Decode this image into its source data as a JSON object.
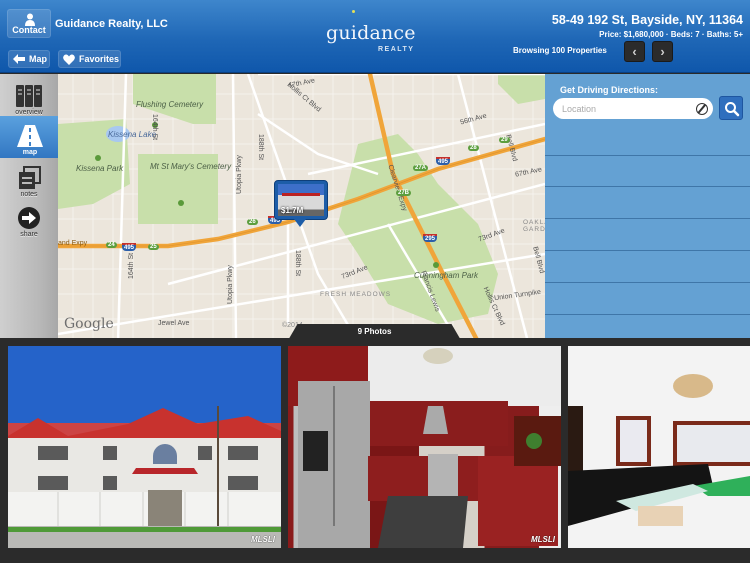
{
  "header": {
    "contact_label": "Contact",
    "company": "Guidance Realty, LLC",
    "map_label": "Map",
    "favorites_label": "Favorites",
    "logo_word": "guidance",
    "logo_sub": "REALTY",
    "address": "58-49 192 St, Bayside, NY, 11364",
    "details": "Price: $1,680,000 · Beds: 7 · Baths: 5+",
    "browsing": "Browsing 100 Properties",
    "prev_glyph": "‹",
    "next_glyph": "›"
  },
  "sidebar": {
    "items": [
      {
        "label": "overview",
        "icon": "columns-icon"
      },
      {
        "label": "map",
        "icon": "road-icon",
        "active": true
      },
      {
        "label": "notes",
        "icon": "notes-icon"
      },
      {
        "label": "share",
        "icon": "share-arrow-icon"
      }
    ]
  },
  "map": {
    "labels": {
      "flushing_cemetery": "Flushing Cemetery",
      "kissena_lake": "Kissena Lake",
      "kissena_park": "Kissena Park",
      "mt_st_marys": "Mt St Mary's Cemetery",
      "cunningham_park": "Cunningham Park",
      "fresh_meadows": "FRESH MEADOWS",
      "oakland_gardens": "OAKLA GARDE",
      "ave_47": "47th Ave",
      "ave_56": "56th Ave",
      "ave_67": "67th Ave",
      "ave_73a": "73rd Ave",
      "ave_73b": "73rd Ave",
      "jewel_ave": "Jewel Ave",
      "union_tpke": "Union Turnpike",
      "hollis_ct_blvd": "Hollis Ct Blvd",
      "hollis_ct_blvd2": "Hollis Ct Blvd",
      "clearview": "Clearview Expy",
      "lie": "and Expy",
      "st_164": "164th St",
      "st_164b": "164th St",
      "st_188": "188th St",
      "st_188b": "188th St",
      "utopia": "Utopia Pkwy",
      "utopia2": "Utopia Pkwy",
      "francis_lewis": "Francis Lewis",
      "bell_blvd": "Bell Blvd",
      "bell_blvd2": "Bell Blvd"
    },
    "shields": [
      "24",
      "25",
      "26",
      "27A",
      "27B",
      "28",
      "29"
    ],
    "interstates": [
      "495",
      "495",
      "495",
      "295"
    ],
    "google": "Google",
    "copyright": "©2014",
    "pin_price": "$1.7M"
  },
  "directions": {
    "title": "Get Driving Directions:",
    "placeholder": "Location",
    "value": ""
  },
  "photos": {
    "tab_label": "9 Photos",
    "watermark": "MLSLI",
    "items": [
      {
        "alt": "House exterior"
      },
      {
        "alt": "Kitchen"
      },
      {
        "alt": "Living room"
      }
    ]
  }
}
